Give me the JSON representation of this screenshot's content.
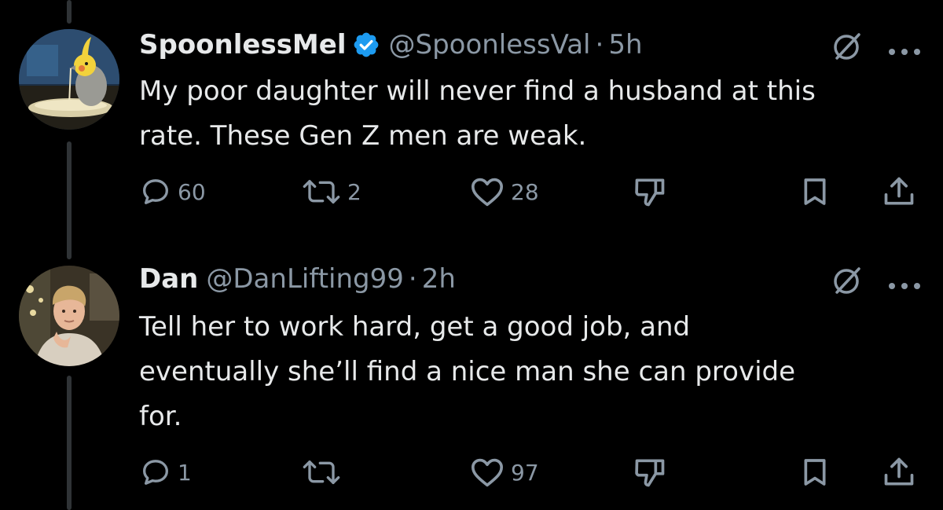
{
  "tweets": [
    {
      "display_name": "SpoonlessMel",
      "verified": true,
      "handle": "@SpoonlessVal",
      "separator": "·",
      "time": "5h",
      "text_lines": [
        "My poor daughter will never find a husband at this",
        "rate. These Gen Z men are weak."
      ],
      "replies": "60",
      "reposts": "2",
      "likes": "28"
    },
    {
      "display_name": "Dan",
      "verified": false,
      "handle": "@DanLifting99",
      "separator": "·",
      "time": "2h",
      "text_lines": [
        "Tell her to work hard, get a good job, and",
        "eventually she’ll find a nice man she can provide",
        "for."
      ],
      "replies": "1",
      "reposts": "",
      "likes": "97"
    }
  ],
  "icons": {
    "reply": "reply-icon",
    "repost": "repost-icon",
    "like": "heart-icon",
    "dislike": "thumbs-down-icon",
    "bookmark": "bookmark-icon",
    "share": "share-icon",
    "grok": "grok-icon",
    "more": "more-icon",
    "verified": "verified-badge-icon"
  },
  "colors": {
    "background": "#000000",
    "text": "#e7e9ea",
    "secondary": "#8b98a5",
    "verified": "#1d9bf0",
    "thread_line": "#2f3336"
  }
}
